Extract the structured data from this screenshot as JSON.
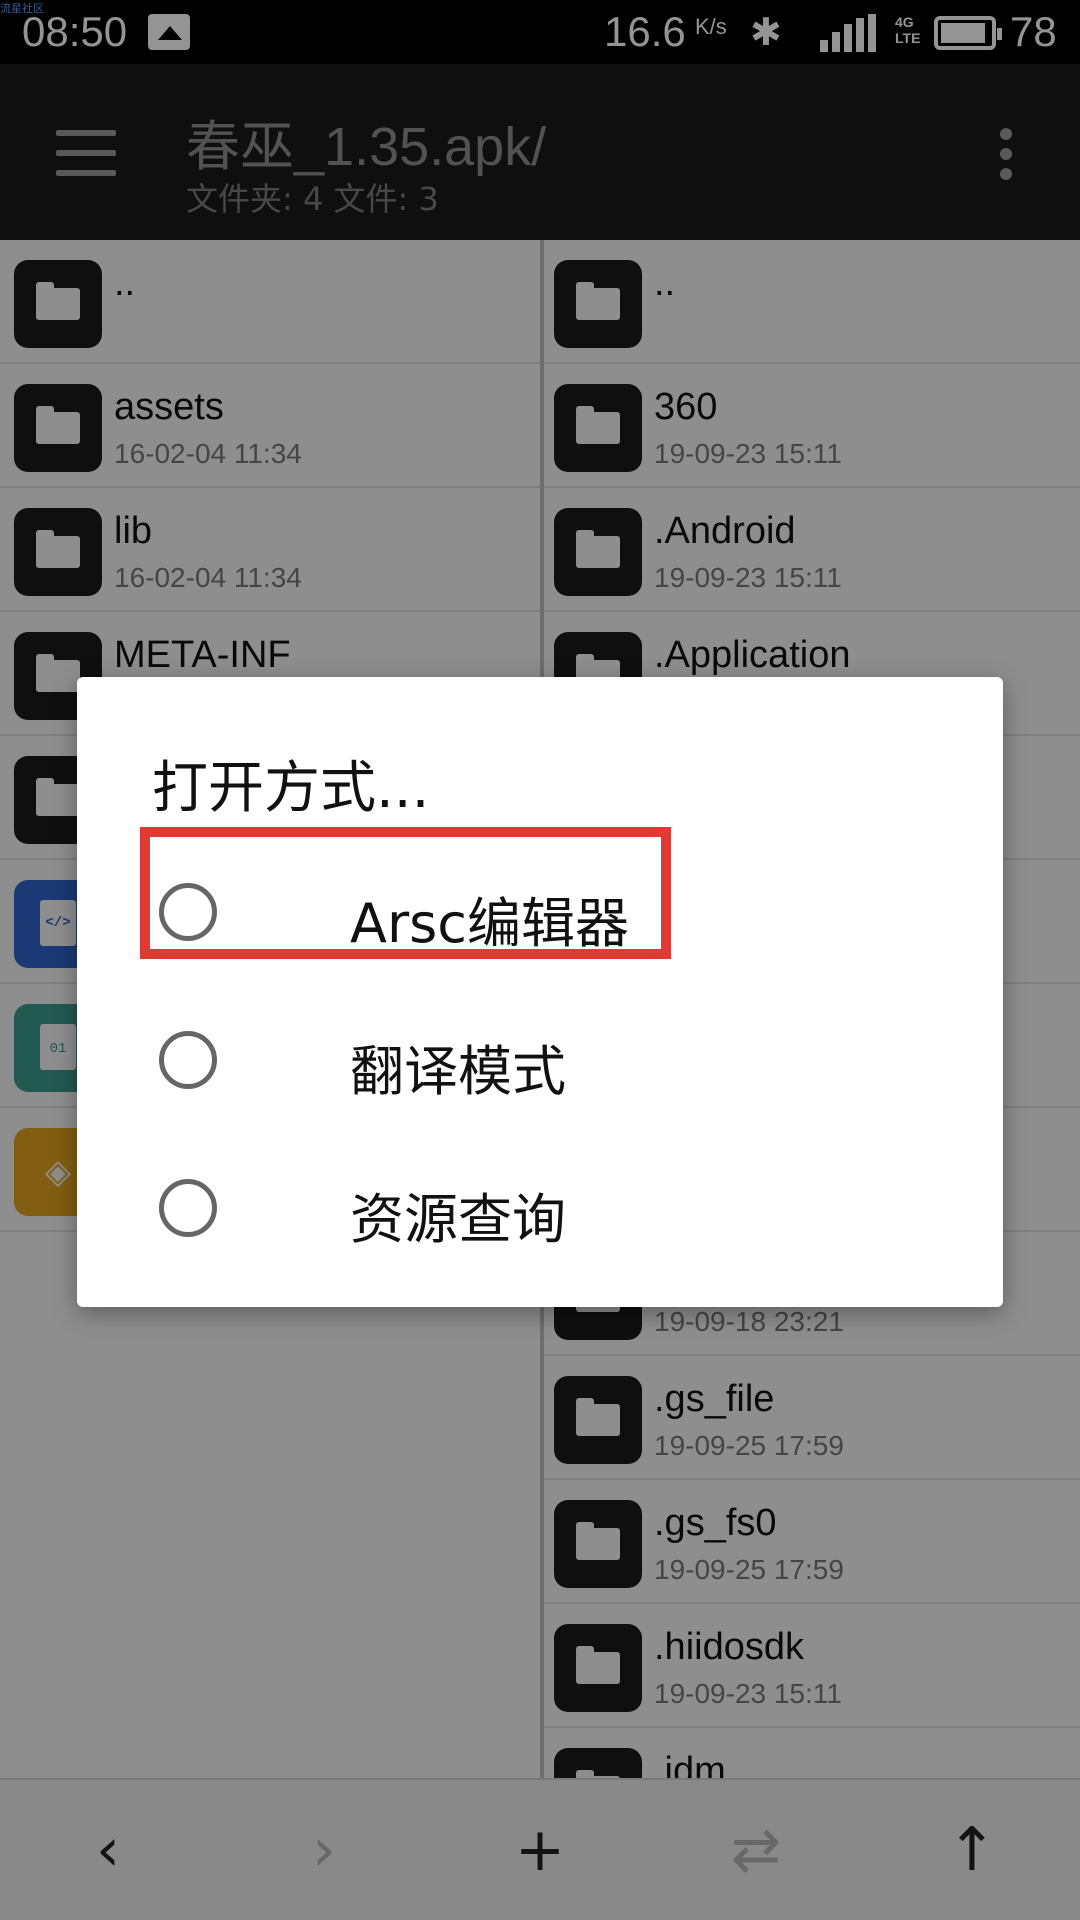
{
  "status_bar": {
    "time": "08:50",
    "watermark": "流星社区",
    "network_speed": "16.6",
    "network_speed_unit": "K/s",
    "network_type_top": "4G",
    "network_type_bottom": "LTE",
    "battery_level": "78"
  },
  "toolbar": {
    "path": "春巫_1.35.apk/",
    "summary": "文件夹: 4  文件: 3"
  },
  "left_pane": {
    "rows": [
      {
        "name": "..",
        "date": "",
        "icon": "folder-icon"
      },
      {
        "name": "assets",
        "date": "16-02-04 11:34",
        "icon": "folder-icon"
      },
      {
        "name": "lib",
        "date": "16-02-04 11:34",
        "icon": "folder-icon"
      },
      {
        "name": "META-INF",
        "date": "",
        "icon": "folder-icon"
      },
      {
        "name": "",
        "date": "",
        "icon": "folder-icon"
      },
      {
        "name": "",
        "date": "",
        "icon": "xml-file-icon"
      },
      {
        "name": "",
        "date": "",
        "icon": "binary-file-icon"
      },
      {
        "name": "",
        "date": "",
        "icon": "layers-file-icon"
      }
    ]
  },
  "right_pane": {
    "rows": [
      {
        "name": "..",
        "date": ""
      },
      {
        "name": "360",
        "date": "19-09-23 15:11"
      },
      {
        "name": ".Android",
        "date": "19-09-23 15:11"
      },
      {
        "name": ".Application",
        "date": ""
      },
      {
        "name": "",
        "date": ""
      },
      {
        "name": "",
        "date": ""
      },
      {
        "name": "",
        "date": ""
      },
      {
        "name": "",
        "date": ""
      },
      {
        "name": "",
        "date": "19-09-18 23:21"
      },
      {
        "name": ".gs_file",
        "date": "19-09-25 17:59"
      },
      {
        "name": ".gs_fs0",
        "date": "19-09-25 17:59"
      },
      {
        "name": ".hiidosdk",
        "date": "19-09-23 15:11"
      },
      {
        "name": ".idm",
        "date": ""
      }
    ]
  },
  "bottom_bar": {
    "back": "‹",
    "forward": "›",
    "add": "+",
    "swap": "⇄",
    "up": "↑"
  },
  "dialog": {
    "title": "打开方式...",
    "options": [
      {
        "label": "Arsc编辑器",
        "selected": false
      },
      {
        "label": "翻译模式",
        "selected": false
      },
      {
        "label": "资源查询",
        "selected": false
      }
    ]
  },
  "colors": {
    "toolbar_bg": "#1b1b1b",
    "highlight": "#e03a34",
    "xml_icon": "#2f63c8",
    "binary_icon": "#3c9a8a",
    "layers_icon": "#e0a020"
  }
}
